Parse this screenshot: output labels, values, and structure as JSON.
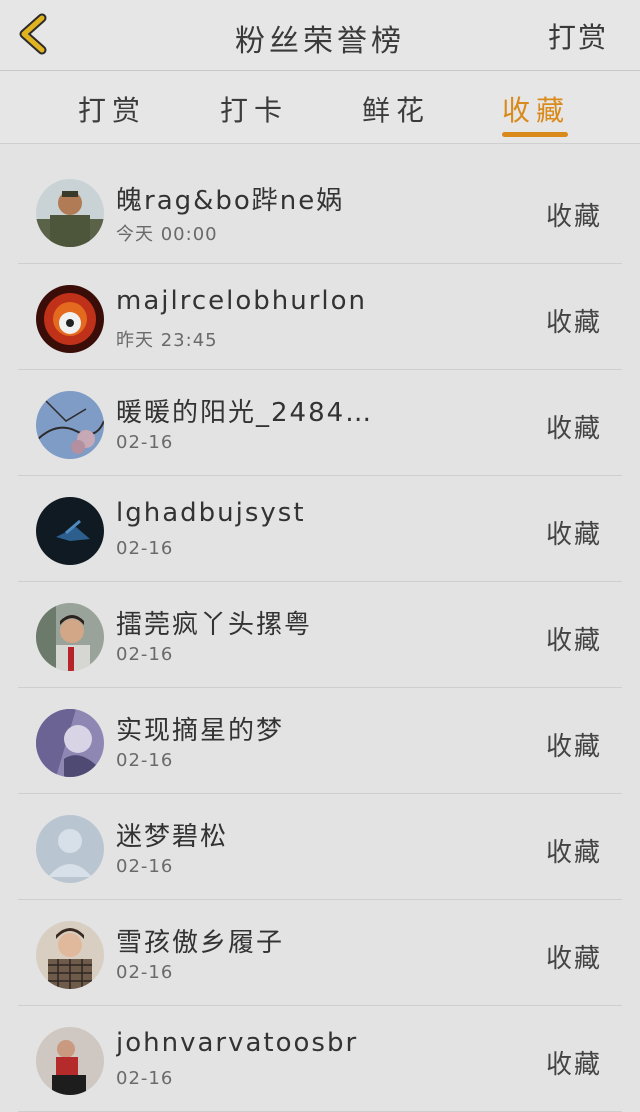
{
  "header": {
    "title": "粉丝荣誉榜",
    "right_action": "打赏",
    "back_icon": "chevron-left-icon"
  },
  "tabs": [
    {
      "label": "打赏"
    },
    {
      "label": "打卡"
    },
    {
      "label": "鲜花"
    },
    {
      "label": "收藏",
      "active": true
    }
  ],
  "accent_color": "#d98a1a",
  "list": [
    {
      "name": "魄rag&bo跸ne娲",
      "time": "今天 00:00",
      "action": "收藏",
      "avatar": "soldier"
    },
    {
      "name": "majlrcelobhurlon",
      "time": "昨天 23:45",
      "action": "收藏",
      "avatar": "fire-ball"
    },
    {
      "name": "暖暖的阳光_2484…",
      "time": "02-16",
      "action": "收藏",
      "avatar": "blossom"
    },
    {
      "name": "lghadbujsyst",
      "time": "02-16",
      "action": "收藏",
      "avatar": "dark-bird"
    },
    {
      "name": "擂莞疯丫头摞粤",
      "time": "02-16",
      "action": "收藏",
      "avatar": "boy"
    },
    {
      "name": "实现摘星的梦",
      "time": "02-16",
      "action": "收藏",
      "avatar": "purple"
    },
    {
      "name": "迷梦碧松",
      "time": "02-16",
      "action": "收藏",
      "avatar": "default"
    },
    {
      "name": "雪孩傲乡履子",
      "time": "02-16",
      "action": "收藏",
      "avatar": "plaid"
    },
    {
      "name": "johnvarvatoosbr",
      "time": "02-16",
      "action": "收藏",
      "avatar": "red-figure"
    }
  ]
}
